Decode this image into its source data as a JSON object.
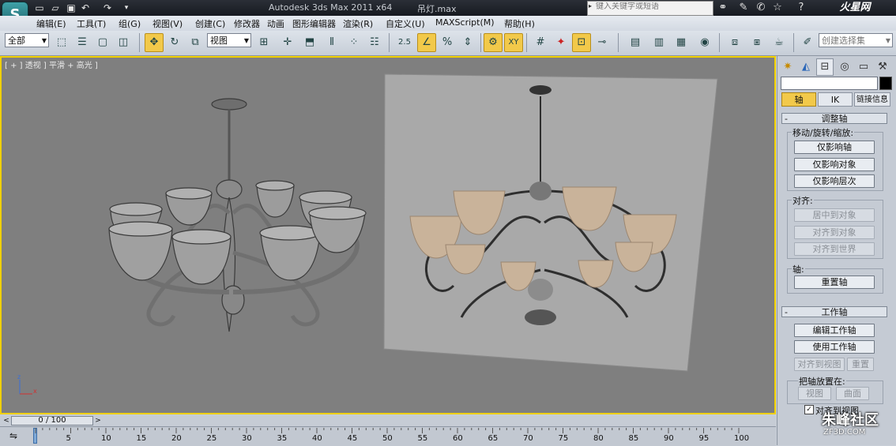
{
  "titlebar": {
    "app_title": "Autodesk 3ds Max  2011 x64",
    "file_title": "吊灯.max",
    "search_placeholder": "键入关键字或短语",
    "brand": "火星网"
  },
  "menu": [
    "编辑(E)",
    "工具(T)",
    "组(G)",
    "视图(V)",
    "创建(C)",
    "修改器",
    "动画",
    "图形编辑器",
    "渲染(R)",
    "自定义(U)",
    "MAXScript(M)",
    "帮助(H)"
  ],
  "toolbar": {
    "selection_filter": "全部",
    "reference_coord": "视图",
    "snap_label": "2.5",
    "named_selection": "创建选择集"
  },
  "viewport": {
    "label": "[ + ] 透视 ] 平滑 + 高光 ]",
    "axes": {
      "x": "x",
      "y": "y",
      "z": "z"
    }
  },
  "command_panel": {
    "tabs": {
      "axis": "轴",
      "ik": "IK",
      "link_info": "链接信息"
    },
    "adjust_pivot": {
      "title": "调整轴",
      "move_group": "移动/旋转/缩放:",
      "affect_pivot_only": "仅影响轴",
      "affect_object_only": "仅影响对象",
      "affect_hierarchy_only": "仅影响层次",
      "align_group": "对齐:",
      "center_to_object": "居中到对象",
      "align_to_object": "对齐到对象",
      "align_to_world": "对齐到世界",
      "pivot_group": "轴:",
      "reset_pivot": "重置轴"
    },
    "working_pivot": {
      "title": "工作轴",
      "edit_working_pivot": "编辑工作轴",
      "use_working_pivot": "使用工作轴",
      "align_to_view": "对齐到视图",
      "reset": "重置",
      "place_pivot_group": "把轴放置在:",
      "view": "视图",
      "surface": "曲面",
      "align_to_view_check": "对齐到视图"
    }
  },
  "timeline": {
    "frame": "0 / 100",
    "prev": "<",
    "next": ">",
    "ticks": [
      "5",
      "10",
      "15",
      "20",
      "25",
      "30",
      "35",
      "40",
      "45",
      "50",
      "55",
      "60",
      "65",
      "70",
      "75",
      "80",
      "85",
      "90",
      "95",
      "100"
    ]
  },
  "watermark": {
    "main": "朱峰社区",
    "sub": "ZF3D.COM"
  }
}
